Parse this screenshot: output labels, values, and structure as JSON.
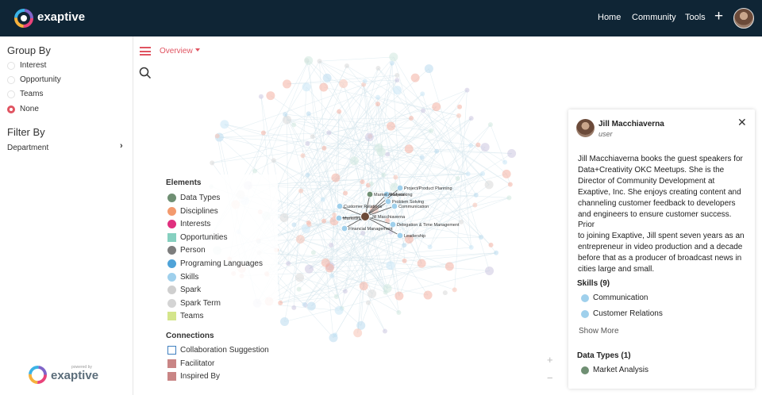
{
  "header": {
    "logo_text": "exaptive",
    "nav": [
      "Home",
      "Community",
      "Tools"
    ],
    "add_icon": "plus-icon",
    "avatar_icon": "user-avatar"
  },
  "sidebar": {
    "group_by_title": "Group By",
    "group_by_options": [
      {
        "label": "Interest",
        "selected": false
      },
      {
        "label": "Opportunity",
        "selected": false
      },
      {
        "label": "Teams",
        "selected": false
      },
      {
        "label": "None",
        "selected": true
      }
    ],
    "filter_by_title": "Filter By",
    "filter_item": "Department",
    "filter_icon": "chevron-right-icon",
    "powered_small": "powered by",
    "powered_text": "exaptive"
  },
  "toolbar": {
    "menu_icon": "hamburger-menu-icon",
    "view_label": "Overview",
    "search_icon": "search-icon"
  },
  "graph": {
    "labels": [
      "Project/Product Planning",
      "Networking",
      "Market Analysis",
      "Problem Solving",
      "Customer Relations",
      "Communication",
      "Marketing",
      "Jill Macchiaverna",
      "Delegation & Time Management",
      "Financial Management",
      "Leadership"
    ]
  },
  "legend": {
    "elements_title": "Elements",
    "elements": [
      {
        "label": "Data Types",
        "color": "#6f8f73",
        "shape": "circle"
      },
      {
        "label": "Disciplines",
        "color": "#f39a6e",
        "shape": "circle"
      },
      {
        "label": "Interests",
        "color": "#e0307e",
        "shape": "circle"
      },
      {
        "label": "Opportunities",
        "color": "#86d0c0",
        "shape": "square"
      },
      {
        "label": "Person",
        "color": "#7d7d7d",
        "shape": "circle"
      },
      {
        "label": "Programing Languages",
        "color": "#4fa3d8",
        "shape": "circle"
      },
      {
        "label": "Skills",
        "color": "#9fd0ec",
        "shape": "circle"
      },
      {
        "label": "Spark",
        "color": "#cfcfcf",
        "shape": "circle"
      },
      {
        "label": "Spark Term",
        "color": "#d4d4d4",
        "shape": "circle"
      },
      {
        "label": "Teams",
        "color": "#d4e58b",
        "shape": "square"
      }
    ],
    "connections_title": "Connections",
    "connections": [
      {
        "label": "Collaboration Suggestion",
        "color": "#3f7fc0",
        "shape": "outline"
      },
      {
        "label": "Facilitator",
        "color": "#c98585",
        "shape": "square"
      },
      {
        "label": "Inspired By",
        "color": "#c98585",
        "shape": "square"
      }
    ]
  },
  "zoom": {
    "in": "+",
    "out": "−"
  },
  "profile": {
    "name": "Jill Macchiaverna",
    "role": "user",
    "close_icon": "close-icon",
    "bio_lines": [
      "Jill Macchiaverna books the guest speakers for",
      "Data+Creativity OKC Meetups. She is the",
      "Director of Community Development at",
      "Exaptive, Inc. She enjoys creating content and",
      "channeling customer feedback to developers",
      "and engineers to ensure customer success. Prior",
      "to joining Exaptive, Jill spent seven years as an",
      "entrepreneur in video production and a decade",
      "before that as a producer of broadcast news in",
      "cities large and small."
    ],
    "skills_title": "Skills (9)",
    "skills": [
      "Communication",
      "Customer Relations"
    ],
    "show_more": "Show More",
    "data_types_title": "Data Types (1)",
    "data_types": [
      "Market Analysis"
    ]
  }
}
